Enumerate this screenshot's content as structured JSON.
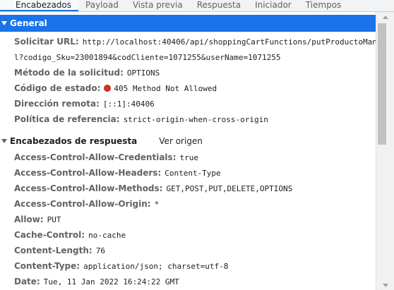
{
  "tabs": [
    "Encabezados",
    "Payload",
    "Vista previa",
    "Respuesta",
    "Iniciador",
    "Tiempos"
  ],
  "general": {
    "title": "General",
    "request_url_label": "Solicitar URL:",
    "request_url_line1": "http://localhost:40406/api/shoppingCartFunctions/putProductoManua",
    "request_url_line2": "l?codigo_Sku=23001894&codCliente=1071255&userName=1071255",
    "method_label": "Método de la solicitud:",
    "method_value": "OPTIONS",
    "status_label": "Código de estado:",
    "status_value": "405 Method Not Allowed",
    "status_color": "#d93025",
    "remote_label": "Dirección remota:",
    "remote_value": "[::1]:40406",
    "referrer_label": "Política de referencia:",
    "referrer_value": "strict-origin-when-cross-origin"
  },
  "response_headers": {
    "title": "Encabezados de respuesta",
    "view_source": "Ver origen",
    "items": [
      {
        "key": "Access-Control-Allow-Credentials:",
        "value": "true"
      },
      {
        "key": "Access-Control-Allow-Headers:",
        "value": "Content-Type"
      },
      {
        "key": "Access-Control-Allow-Methods:",
        "value": "GET,POST,PUT,DELETE,OPTIONS"
      },
      {
        "key": "Access-Control-Allow-Origin:",
        "value": "*"
      },
      {
        "key": "Allow:",
        "value": "PUT"
      },
      {
        "key": "Cache-Control:",
        "value": "no-cache"
      },
      {
        "key": "Content-Length:",
        "value": "76"
      },
      {
        "key": "Content-Type:",
        "value": "application/json; charset=utf-8"
      },
      {
        "key": "Date:",
        "value": "Tue, 11 Jan 2022 16:24:22 GMT"
      }
    ]
  },
  "colors": {
    "accent": "#1a73e8",
    "status_error": "#d93025"
  }
}
